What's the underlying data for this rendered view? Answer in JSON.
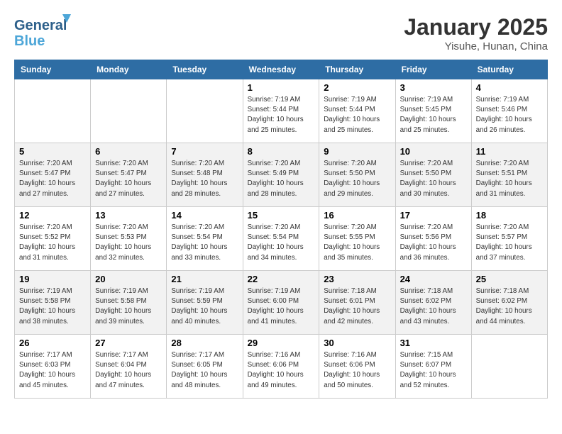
{
  "header": {
    "logo_general": "General",
    "logo_blue": "Blue",
    "month_title": "January 2025",
    "location": "Yisuhe, Hunan, China"
  },
  "days_of_week": [
    "Sunday",
    "Monday",
    "Tuesday",
    "Wednesday",
    "Thursday",
    "Friday",
    "Saturday"
  ],
  "weeks": [
    [
      {
        "day": "",
        "info": ""
      },
      {
        "day": "",
        "info": ""
      },
      {
        "day": "",
        "info": ""
      },
      {
        "day": "1",
        "info": "Sunrise: 7:19 AM\nSunset: 5:44 PM\nDaylight: 10 hours\nand 25 minutes."
      },
      {
        "day": "2",
        "info": "Sunrise: 7:19 AM\nSunset: 5:44 PM\nDaylight: 10 hours\nand 25 minutes."
      },
      {
        "day": "3",
        "info": "Sunrise: 7:19 AM\nSunset: 5:45 PM\nDaylight: 10 hours\nand 25 minutes."
      },
      {
        "day": "4",
        "info": "Sunrise: 7:19 AM\nSunset: 5:46 PM\nDaylight: 10 hours\nand 26 minutes."
      }
    ],
    [
      {
        "day": "5",
        "info": "Sunrise: 7:20 AM\nSunset: 5:47 PM\nDaylight: 10 hours\nand 27 minutes."
      },
      {
        "day": "6",
        "info": "Sunrise: 7:20 AM\nSunset: 5:47 PM\nDaylight: 10 hours\nand 27 minutes."
      },
      {
        "day": "7",
        "info": "Sunrise: 7:20 AM\nSunset: 5:48 PM\nDaylight: 10 hours\nand 28 minutes."
      },
      {
        "day": "8",
        "info": "Sunrise: 7:20 AM\nSunset: 5:49 PM\nDaylight: 10 hours\nand 28 minutes."
      },
      {
        "day": "9",
        "info": "Sunrise: 7:20 AM\nSunset: 5:50 PM\nDaylight: 10 hours\nand 29 minutes."
      },
      {
        "day": "10",
        "info": "Sunrise: 7:20 AM\nSunset: 5:50 PM\nDaylight: 10 hours\nand 30 minutes."
      },
      {
        "day": "11",
        "info": "Sunrise: 7:20 AM\nSunset: 5:51 PM\nDaylight: 10 hours\nand 31 minutes."
      }
    ],
    [
      {
        "day": "12",
        "info": "Sunrise: 7:20 AM\nSunset: 5:52 PM\nDaylight: 10 hours\nand 31 minutes."
      },
      {
        "day": "13",
        "info": "Sunrise: 7:20 AM\nSunset: 5:53 PM\nDaylight: 10 hours\nand 32 minutes."
      },
      {
        "day": "14",
        "info": "Sunrise: 7:20 AM\nSunset: 5:54 PM\nDaylight: 10 hours\nand 33 minutes."
      },
      {
        "day": "15",
        "info": "Sunrise: 7:20 AM\nSunset: 5:54 PM\nDaylight: 10 hours\nand 34 minutes."
      },
      {
        "day": "16",
        "info": "Sunrise: 7:20 AM\nSunset: 5:55 PM\nDaylight: 10 hours\nand 35 minutes."
      },
      {
        "day": "17",
        "info": "Sunrise: 7:20 AM\nSunset: 5:56 PM\nDaylight: 10 hours\nand 36 minutes."
      },
      {
        "day": "18",
        "info": "Sunrise: 7:20 AM\nSunset: 5:57 PM\nDaylight: 10 hours\nand 37 minutes."
      }
    ],
    [
      {
        "day": "19",
        "info": "Sunrise: 7:19 AM\nSunset: 5:58 PM\nDaylight: 10 hours\nand 38 minutes."
      },
      {
        "day": "20",
        "info": "Sunrise: 7:19 AM\nSunset: 5:58 PM\nDaylight: 10 hours\nand 39 minutes."
      },
      {
        "day": "21",
        "info": "Sunrise: 7:19 AM\nSunset: 5:59 PM\nDaylight: 10 hours\nand 40 minutes."
      },
      {
        "day": "22",
        "info": "Sunrise: 7:19 AM\nSunset: 6:00 PM\nDaylight: 10 hours\nand 41 minutes."
      },
      {
        "day": "23",
        "info": "Sunrise: 7:18 AM\nSunset: 6:01 PM\nDaylight: 10 hours\nand 42 minutes."
      },
      {
        "day": "24",
        "info": "Sunrise: 7:18 AM\nSunset: 6:02 PM\nDaylight: 10 hours\nand 43 minutes."
      },
      {
        "day": "25",
        "info": "Sunrise: 7:18 AM\nSunset: 6:02 PM\nDaylight: 10 hours\nand 44 minutes."
      }
    ],
    [
      {
        "day": "26",
        "info": "Sunrise: 7:17 AM\nSunset: 6:03 PM\nDaylight: 10 hours\nand 45 minutes."
      },
      {
        "day": "27",
        "info": "Sunrise: 7:17 AM\nSunset: 6:04 PM\nDaylight: 10 hours\nand 47 minutes."
      },
      {
        "day": "28",
        "info": "Sunrise: 7:17 AM\nSunset: 6:05 PM\nDaylight: 10 hours\nand 48 minutes."
      },
      {
        "day": "29",
        "info": "Sunrise: 7:16 AM\nSunset: 6:06 PM\nDaylight: 10 hours\nand 49 minutes."
      },
      {
        "day": "30",
        "info": "Sunrise: 7:16 AM\nSunset: 6:06 PM\nDaylight: 10 hours\nand 50 minutes."
      },
      {
        "day": "31",
        "info": "Sunrise: 7:15 AM\nSunset: 6:07 PM\nDaylight: 10 hours\nand 52 minutes."
      },
      {
        "day": "",
        "info": ""
      }
    ]
  ]
}
